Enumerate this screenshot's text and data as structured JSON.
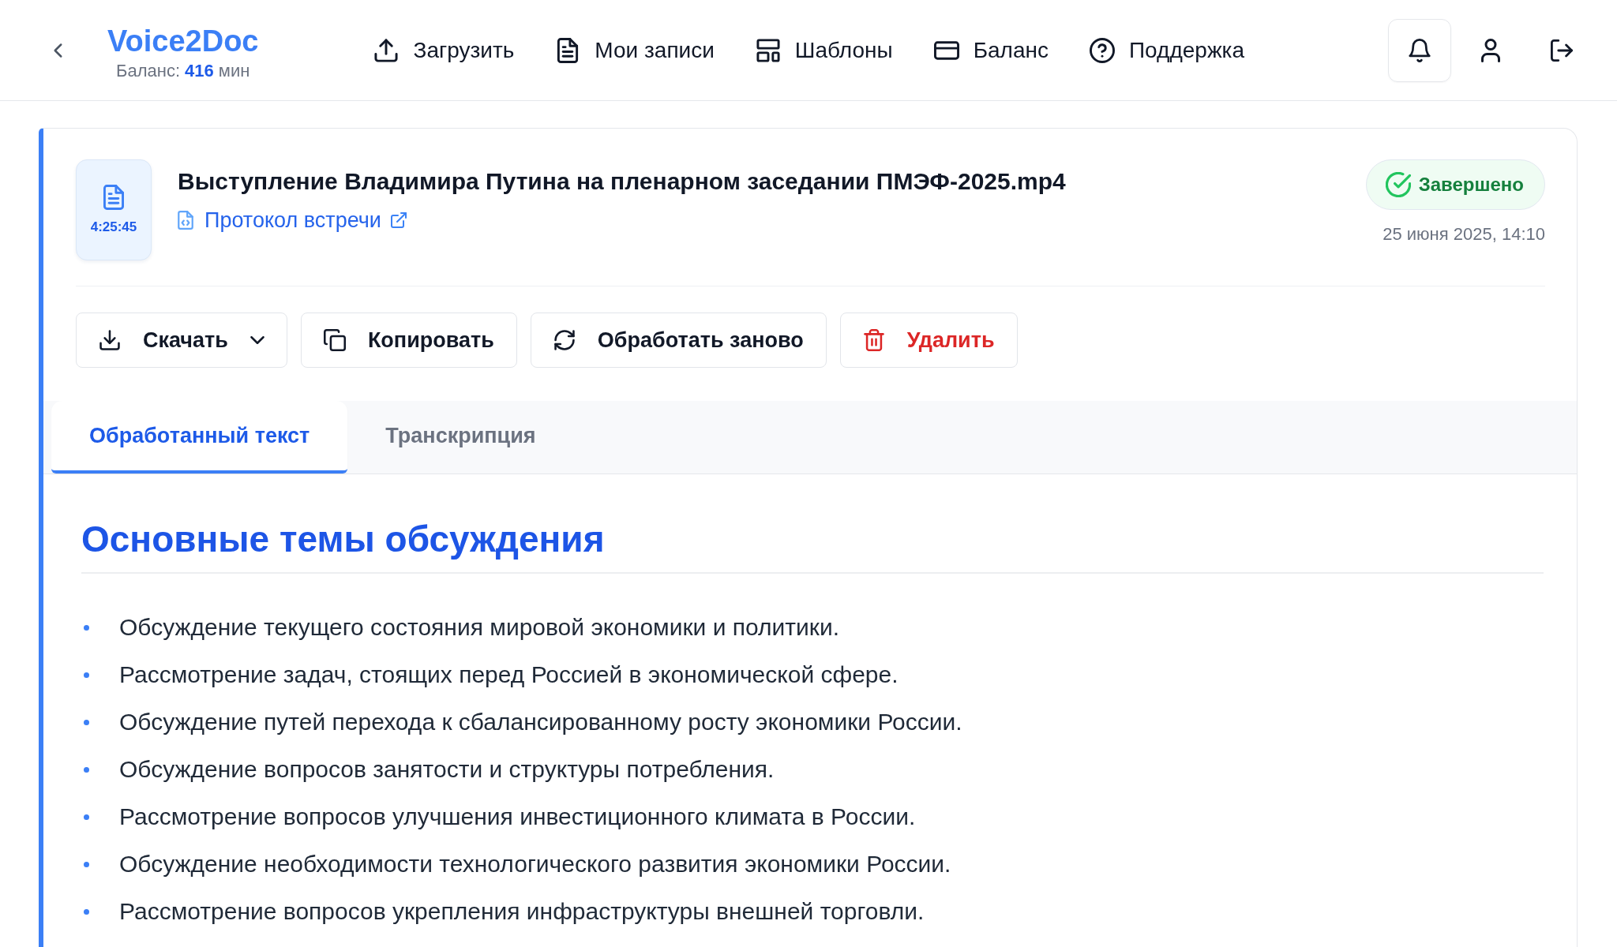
{
  "header": {
    "logo": "Voice2Doc",
    "balance": {
      "label": "Баланс:",
      "value": "416",
      "unit": "мин"
    },
    "nav": [
      {
        "label": "Загрузить"
      },
      {
        "label": "Мои записи"
      },
      {
        "label": "Шаблоны"
      },
      {
        "label": "Баланс"
      },
      {
        "label": "Поддержка"
      }
    ]
  },
  "file": {
    "duration": "4:25:45",
    "title": "Выступление Владимира Путина на пленарном заседании ПМЭФ-2025.mp4",
    "link": "Протокол встречи",
    "status": {
      "label": "Завершено",
      "kind": "done"
    },
    "date": "25 июня 2025, 14:10"
  },
  "buttons": [
    {
      "label": "Скачать",
      "kind": "dropdown"
    },
    {
      "label": "Копировать",
      "kind": "normal"
    },
    {
      "label": "Обработать заново",
      "kind": "normal"
    },
    {
      "label": "Удалить",
      "kind": "danger"
    }
  ],
  "tabs": [
    {
      "label": "Обработанный текст",
      "selected": true
    },
    {
      "label": "Транскрипция",
      "selected": false
    }
  ],
  "content": {
    "heading": "Основные темы обсуждения",
    "items": [
      "Обсуждение текущего состояния мировой экономики и политики.",
      "Рассмотрение задач, стоящих перед Россией в экономической сфере.",
      "Обсуждение путей перехода к сбалансированному росту экономики России.",
      "Обсуждение вопросов занятости и структуры потребления.",
      "Рассмотрение вопросов улучшения инвестиционного климата в России.",
      "Обсуждение необходимости технологического развития экономики России.",
      "Рассмотрение вопросов укрепления инфраструктуры внешней торговли."
    ]
  }
}
